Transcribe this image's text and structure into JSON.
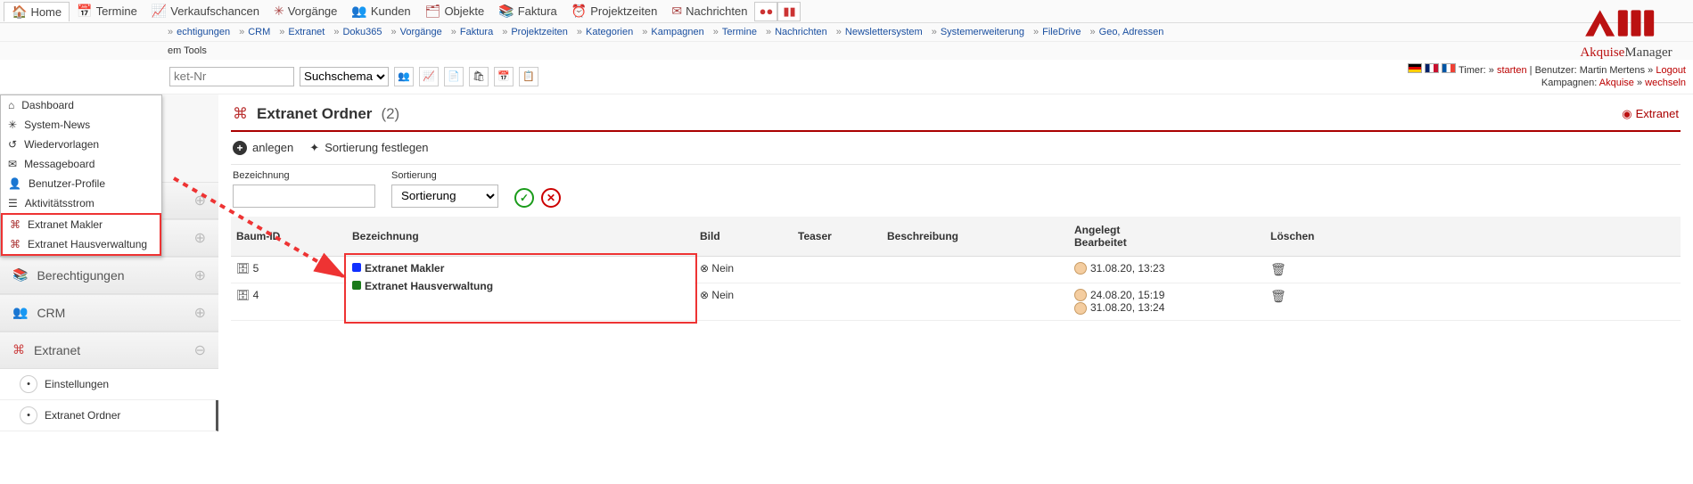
{
  "topmenu": {
    "items": [
      {
        "label": "Home",
        "icon": "🏠"
      },
      {
        "label": "Termine",
        "icon": "📅"
      },
      {
        "label": "Verkaufschancen",
        "icon": "📈"
      },
      {
        "label": "Vorgänge",
        "icon": "✳"
      },
      {
        "label": "Kunden",
        "icon": "👥"
      },
      {
        "label": "Objekte",
        "icon": "🗂"
      },
      {
        "label": "Faktura",
        "icon": "📚"
      },
      {
        "label": "Projektzeiten",
        "icon": "⏰"
      },
      {
        "label": "Nachrichten",
        "icon": "✉"
      }
    ]
  },
  "home_dropdown": {
    "items": [
      {
        "label": "Dashboard",
        "icon": "⌂"
      },
      {
        "label": "System-News",
        "icon": "✳"
      },
      {
        "label": "Wiedervorlagen",
        "icon": "↺"
      },
      {
        "label": "Messageboard",
        "icon": "✉"
      },
      {
        "label": "Benutzer-Profile",
        "icon": "👤"
      },
      {
        "label": "Aktivitätsstrom",
        "icon": "☰"
      }
    ],
    "highlighted_items": [
      {
        "label": "Extranet Makler",
        "icon": "⌘"
      },
      {
        "label": "Extranet Hausverwaltung",
        "icon": "⌘"
      }
    ]
  },
  "secnav": {
    "items_left": [
      "echtigungen",
      "CRM",
      "Extranet",
      "Doku365",
      "Vorgänge",
      "Faktura",
      "Projektzeiten",
      "Kategorien",
      "Kampagnen",
      "Termine",
      "Nachrichten",
      "Newslettersystem",
      "Systemerweiterung",
      "FileDrive",
      "Geo, Adressen"
    ],
    "second_line": "em Tools"
  },
  "util": {
    "search_placeholder": "ket-Nr",
    "scheme_label": "Suchschema",
    "timer_label": "Timer:",
    "timer_start": "starten",
    "user_label": "Benutzer:",
    "user_name": "Martin Mertens",
    "logout": "Logout",
    "camp_label": "Kampagnen:",
    "camp_name": "Akquise",
    "camp_switch": "wechseln"
  },
  "logo": {
    "brand_a": "Akquise",
    "brand_b": "Manager"
  },
  "sidebar": {
    "groups": [
      {
        "label": "Berechtigungen",
        "icon": "📚",
        "expand": "⊕"
      },
      {
        "label": "CRM",
        "icon": "👥",
        "expand": "⊕"
      },
      {
        "label": "Extranet",
        "icon": "⌘",
        "expand": "⊖"
      }
    ],
    "collapsed_top": [
      {
        "expand": "⊕"
      },
      {
        "expand": "⊕"
      }
    ],
    "extranet_children": [
      {
        "label": "Einstellungen"
      },
      {
        "label": "Extranet Ordner"
      }
    ]
  },
  "page": {
    "title": "Extranet Ordner",
    "count": "(2)",
    "tag": "Extranet",
    "tool_new": "anlegen",
    "tool_sort": "Sortierung festlegen",
    "filter_bezeichnung_label": "Bezeichnung",
    "filter_sortierung_label": "Sortierung",
    "filter_sortierung_default": "Sortierung"
  },
  "table": {
    "headers": {
      "baum": "Baum-ID",
      "bez": "Bezeichnung",
      "bild": "Bild",
      "teaser": "Teaser",
      "beschr": "Beschreibung",
      "angelegt": "Angelegt",
      "bearb": "Bearbeitet",
      "loeschen": "Löschen"
    },
    "rows": [
      {
        "baum": "5",
        "bez": "Extranet Makler",
        "color": "#1030ff",
        "bild": "Nein",
        "dates": [
          "31.08.20, 13:23"
        ]
      },
      {
        "baum": "4",
        "bez": "Extranet Hausverwaltung",
        "color": "#1a7a1a",
        "bild": "Nein",
        "dates": [
          "24.08.20, 15:19",
          "31.08.20, 13:24"
        ]
      }
    ]
  }
}
